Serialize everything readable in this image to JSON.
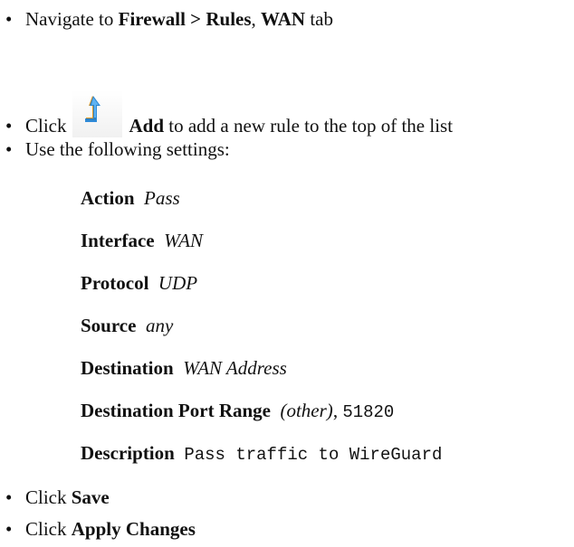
{
  "steps": {
    "nav": {
      "bullet": "•",
      "prefix": "Navigate to ",
      "menu_path": "Firewall > Rules",
      "sep": ", ",
      "tab": "WAN",
      "suffix": " tab"
    },
    "add": {
      "bullet": "•",
      "prefix": "Click",
      "icon": "add-rule-top-arrow-icon",
      "button": "Add",
      "suffix": " to add a new rule to the top of the list"
    },
    "settings_intro": {
      "bullet": "•",
      "text": "Use the following settings:"
    },
    "save": {
      "bullet": "•",
      "prefix": "Click ",
      "button": "Save"
    },
    "apply": {
      "bullet": "•",
      "prefix": "Click ",
      "button": "Apply Changes"
    }
  },
  "settings": {
    "action": {
      "label": "Action",
      "value": "Pass"
    },
    "interface": {
      "label": "Interface",
      "value": "WAN"
    },
    "protocol": {
      "label": "Protocol",
      "value": "UDP"
    },
    "source": {
      "label": "Source",
      "value": "any"
    },
    "destination": {
      "label": "Destination",
      "value": "WAN Address"
    },
    "dest_port": {
      "label": "Destination Port Range",
      "value_italic": "(other)",
      "sep": ", ",
      "value_mono": "51820"
    },
    "description": {
      "label": "Description",
      "value": "Pass traffic to WireGuard"
    }
  },
  "colors": {
    "text": "#111111",
    "icon_blue": "#1a7fd6",
    "icon_orange": "#e39a27"
  }
}
